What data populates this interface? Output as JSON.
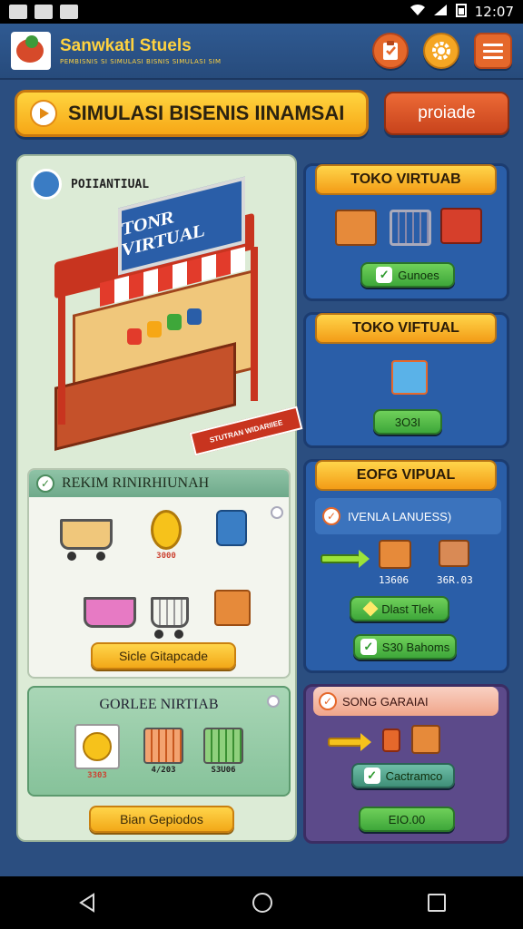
{
  "status_bar": {
    "time": "12:07"
  },
  "header": {
    "app_name": "Sanwkatl Stuels",
    "tagline": "PEMBISNIS SI SIMULASI BISNIS SIMULASI SIM",
    "buttons": [
      {
        "icon": "clipboard-icon"
      },
      {
        "icon": "settings-gear-icon"
      },
      {
        "icon": "menu-icon"
      }
    ]
  },
  "title_bar": {
    "title": "SIMULASI BISENIS IINAMSAI",
    "profile_label": "proiade"
  },
  "left_panel": {
    "header_label": "POIIANTIUAL",
    "shop_sign": "TONR VIRTUAL",
    "shop_banner": "STUTRAN WIDARIIEE",
    "section1": {
      "title": "REKIM RINIRHIUNAH",
      "items": [
        {
          "icon": "shopping-cart-icon",
          "value": ""
        },
        {
          "icon": "coin-icon",
          "value": "3000"
        },
        {
          "icon": "shopping-bag-icon",
          "value": ""
        },
        {
          "icon": "fruit-basket-icon",
          "value": ""
        },
        {
          "icon": "cart-icon",
          "value": ""
        },
        {
          "icon": "box-icon",
          "value": ""
        }
      ],
      "button_label": "Sicle Gitapcade"
    },
    "section2": {
      "title": "GORLEE NIRTIAB",
      "items": [
        {
          "icon": "coins-icon",
          "value": "3303"
        },
        {
          "icon": "basket-icon",
          "value": "4/203"
        },
        {
          "icon": "green-basket-icon",
          "value": "S3U06"
        }
      ],
      "button_label": "Bian Gepiodos"
    }
  },
  "right_column": {
    "card1": {
      "title": "TOKO VIRTUAB",
      "button_label": "Gunoes"
    },
    "card2": {
      "title": "TOKO VIFTUAL",
      "button_label": "3O3I"
    },
    "card3": {
      "title": "EOFG VIPUAL",
      "subtitle": "IVENLA LANUESS)",
      "values": [
        "13606",
        "36R.03"
      ],
      "button1_label": "Dlast Tlek",
      "button2_label": "S30 Bahoms"
    },
    "card4": {
      "title": "SONG GARAIAI",
      "button1_label": "Cactramco",
      "button2_label": "EIO.00"
    }
  },
  "colors": {
    "background": "#2b4e80",
    "accent_yellow": "#ffd54a",
    "accent_orange": "#e5682b",
    "accent_green": "#4fbd46"
  }
}
